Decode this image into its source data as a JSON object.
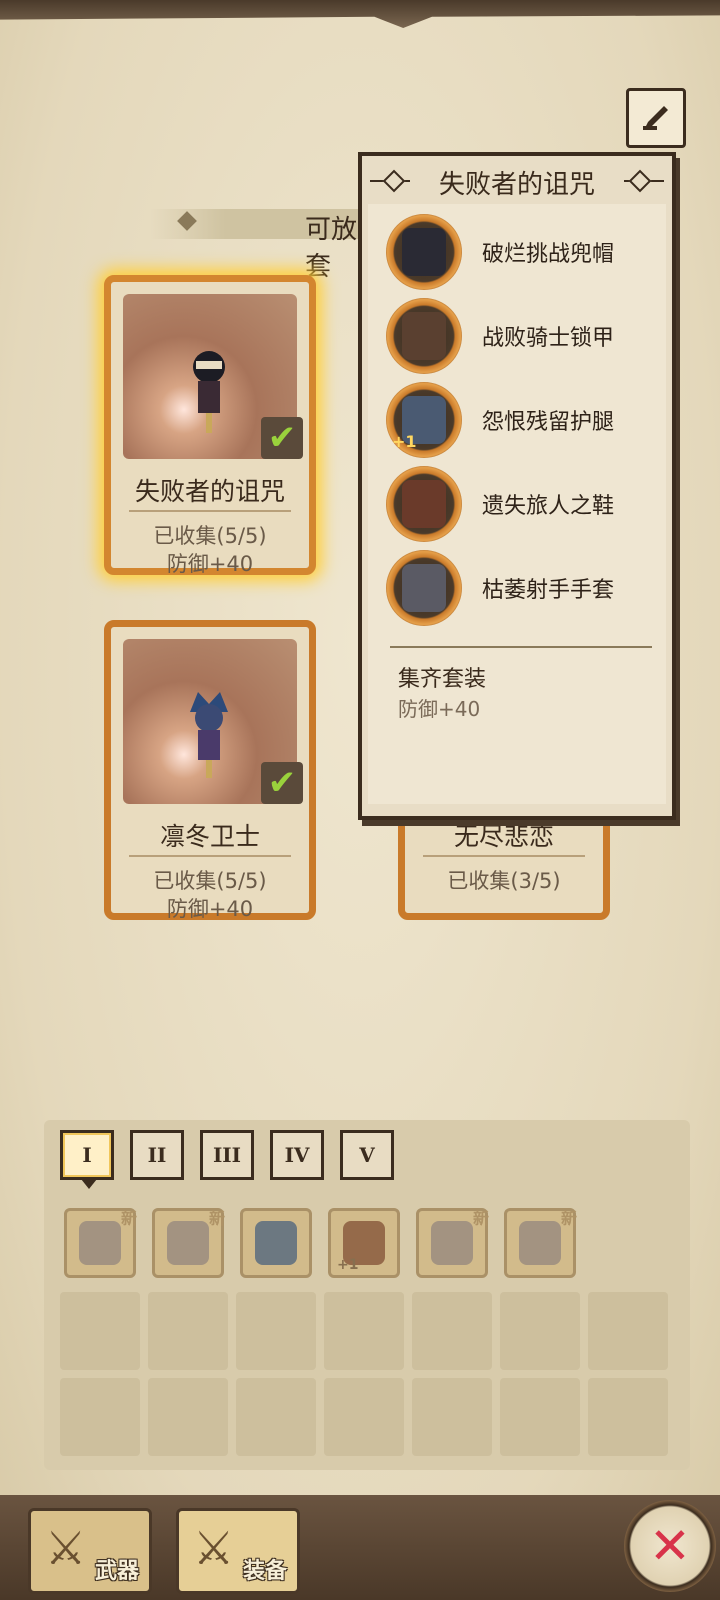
{
  "section_header": {
    "title": "可放入套"
  },
  "toolbar": {
    "edit_icon": "edit-icon"
  },
  "cards": [
    {
      "name": "失败者的诅咒",
      "collected": "已收集(5/5)",
      "bonus": "防御+40",
      "checked": true,
      "selected": true
    },
    {
      "name": "凛冬卫士",
      "collected": "已收集(5/5)",
      "bonus": "防御+40",
      "checked": true,
      "selected": false
    },
    {
      "name": "无尽悲恋",
      "collected": "已收集(3/5)"
    }
  ],
  "popup": {
    "title": "失败者的诅咒",
    "items": [
      {
        "name": "破烂挑战兜帽",
        "icon": "hood-icon"
      },
      {
        "name": "战败骑士锁甲",
        "icon": "chainmail-icon"
      },
      {
        "name": "怨恨残留护腿",
        "icon": "leggings-icon",
        "badge": "+1"
      },
      {
        "name": "遗失旅人之鞋",
        "icon": "boots-icon"
      },
      {
        "name": "枯萎射手手套",
        "icon": "gloves-icon"
      }
    ],
    "set_title": "集齐套装",
    "set_bonus": "防御+40"
  },
  "tier_tabs": [
    "I",
    "II",
    "III",
    "IV",
    "V"
  ],
  "active_tab": "I",
  "inventory": [
    {
      "icon": "helmet-icon",
      "new": "新"
    },
    {
      "icon": "helmet-icon",
      "new": "新"
    },
    {
      "icon": "shoulder-guard-icon"
    },
    {
      "icon": "vest-icon",
      "badge": "+1"
    },
    {
      "icon": "gauntlet-icon",
      "new": "新"
    },
    {
      "icon": "gauntlet-icon",
      "new": "新"
    }
  ],
  "bottom_nav": {
    "weapons": "武器",
    "equipment": "装备",
    "close_icon": "close-icon"
  },
  "colors": {
    "frame_orange": "#c97a2a",
    "selected_glow": "#ffcf3a",
    "check_green": "#9ad23c",
    "close_red": "#d8334a"
  }
}
